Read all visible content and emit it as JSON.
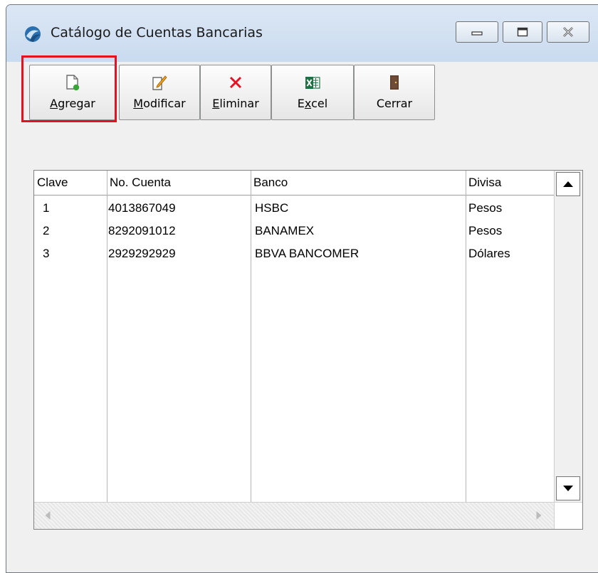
{
  "window": {
    "title": "Catálogo de Cuentas Bancarias"
  },
  "toolbar": {
    "buttons": [
      {
        "pre": "",
        "accel": "A",
        "post": "gregar",
        "icon": "new-document-icon"
      },
      {
        "pre": "",
        "accel": "M",
        "post": "odificar",
        "icon": "edit-icon"
      },
      {
        "pre": "",
        "accel": "E",
        "post": "liminar",
        "icon": "delete-x-icon"
      },
      {
        "pre": "E",
        "accel": "x",
        "post": "cel",
        "icon": "excel-icon"
      },
      {
        "pre": "Cerrar",
        "accel": "",
        "post": "",
        "icon": "door-icon"
      }
    ]
  },
  "grid": {
    "columns": [
      "Clave",
      "No. Cuenta",
      "Banco",
      "Divisa"
    ],
    "rows": [
      {
        "clave": "1",
        "cuenta": "4013867049",
        "banco": "HSBC",
        "divisa": "Pesos"
      },
      {
        "clave": "2",
        "cuenta": "8292091012",
        "banco": "BANAMEX",
        "divisa": "Pesos"
      },
      {
        "clave": "3",
        "cuenta": "2929292929",
        "banco": "BBVA BANCOMER",
        "divisa": "Dólares"
      }
    ]
  },
  "colors": {
    "highlight": "#e3121e",
    "excel_green": "#1e7145",
    "delete_red": "#e81123",
    "new_doc_green": "#3aa63a"
  }
}
